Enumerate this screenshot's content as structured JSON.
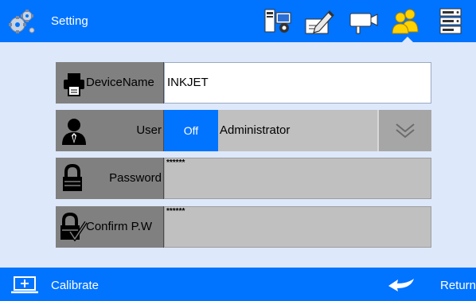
{
  "header": {
    "title": "Setting",
    "icons": [
      "system-info-icon",
      "edit-label-icon",
      "camera-icon",
      "users-icon",
      "server-icon"
    ],
    "active_icon": "users-icon"
  },
  "form": {
    "device_name": {
      "label": "DeviceName",
      "value": "INKJET"
    },
    "user": {
      "label": "User",
      "toggle": "Off",
      "value": "Administrator"
    },
    "password": {
      "label": "Password",
      "value": "******"
    },
    "confirm_password": {
      "label": "Confirm P.W",
      "value": "******"
    }
  },
  "footer": {
    "calibrate_label": "Calibrate",
    "return_label": "Return"
  },
  "colors": {
    "accent": "#0073ff",
    "background": "#dde8fb",
    "label_bg": "#808080",
    "field_gray": "#c0c0c0",
    "active_icon": "#ffd200"
  }
}
